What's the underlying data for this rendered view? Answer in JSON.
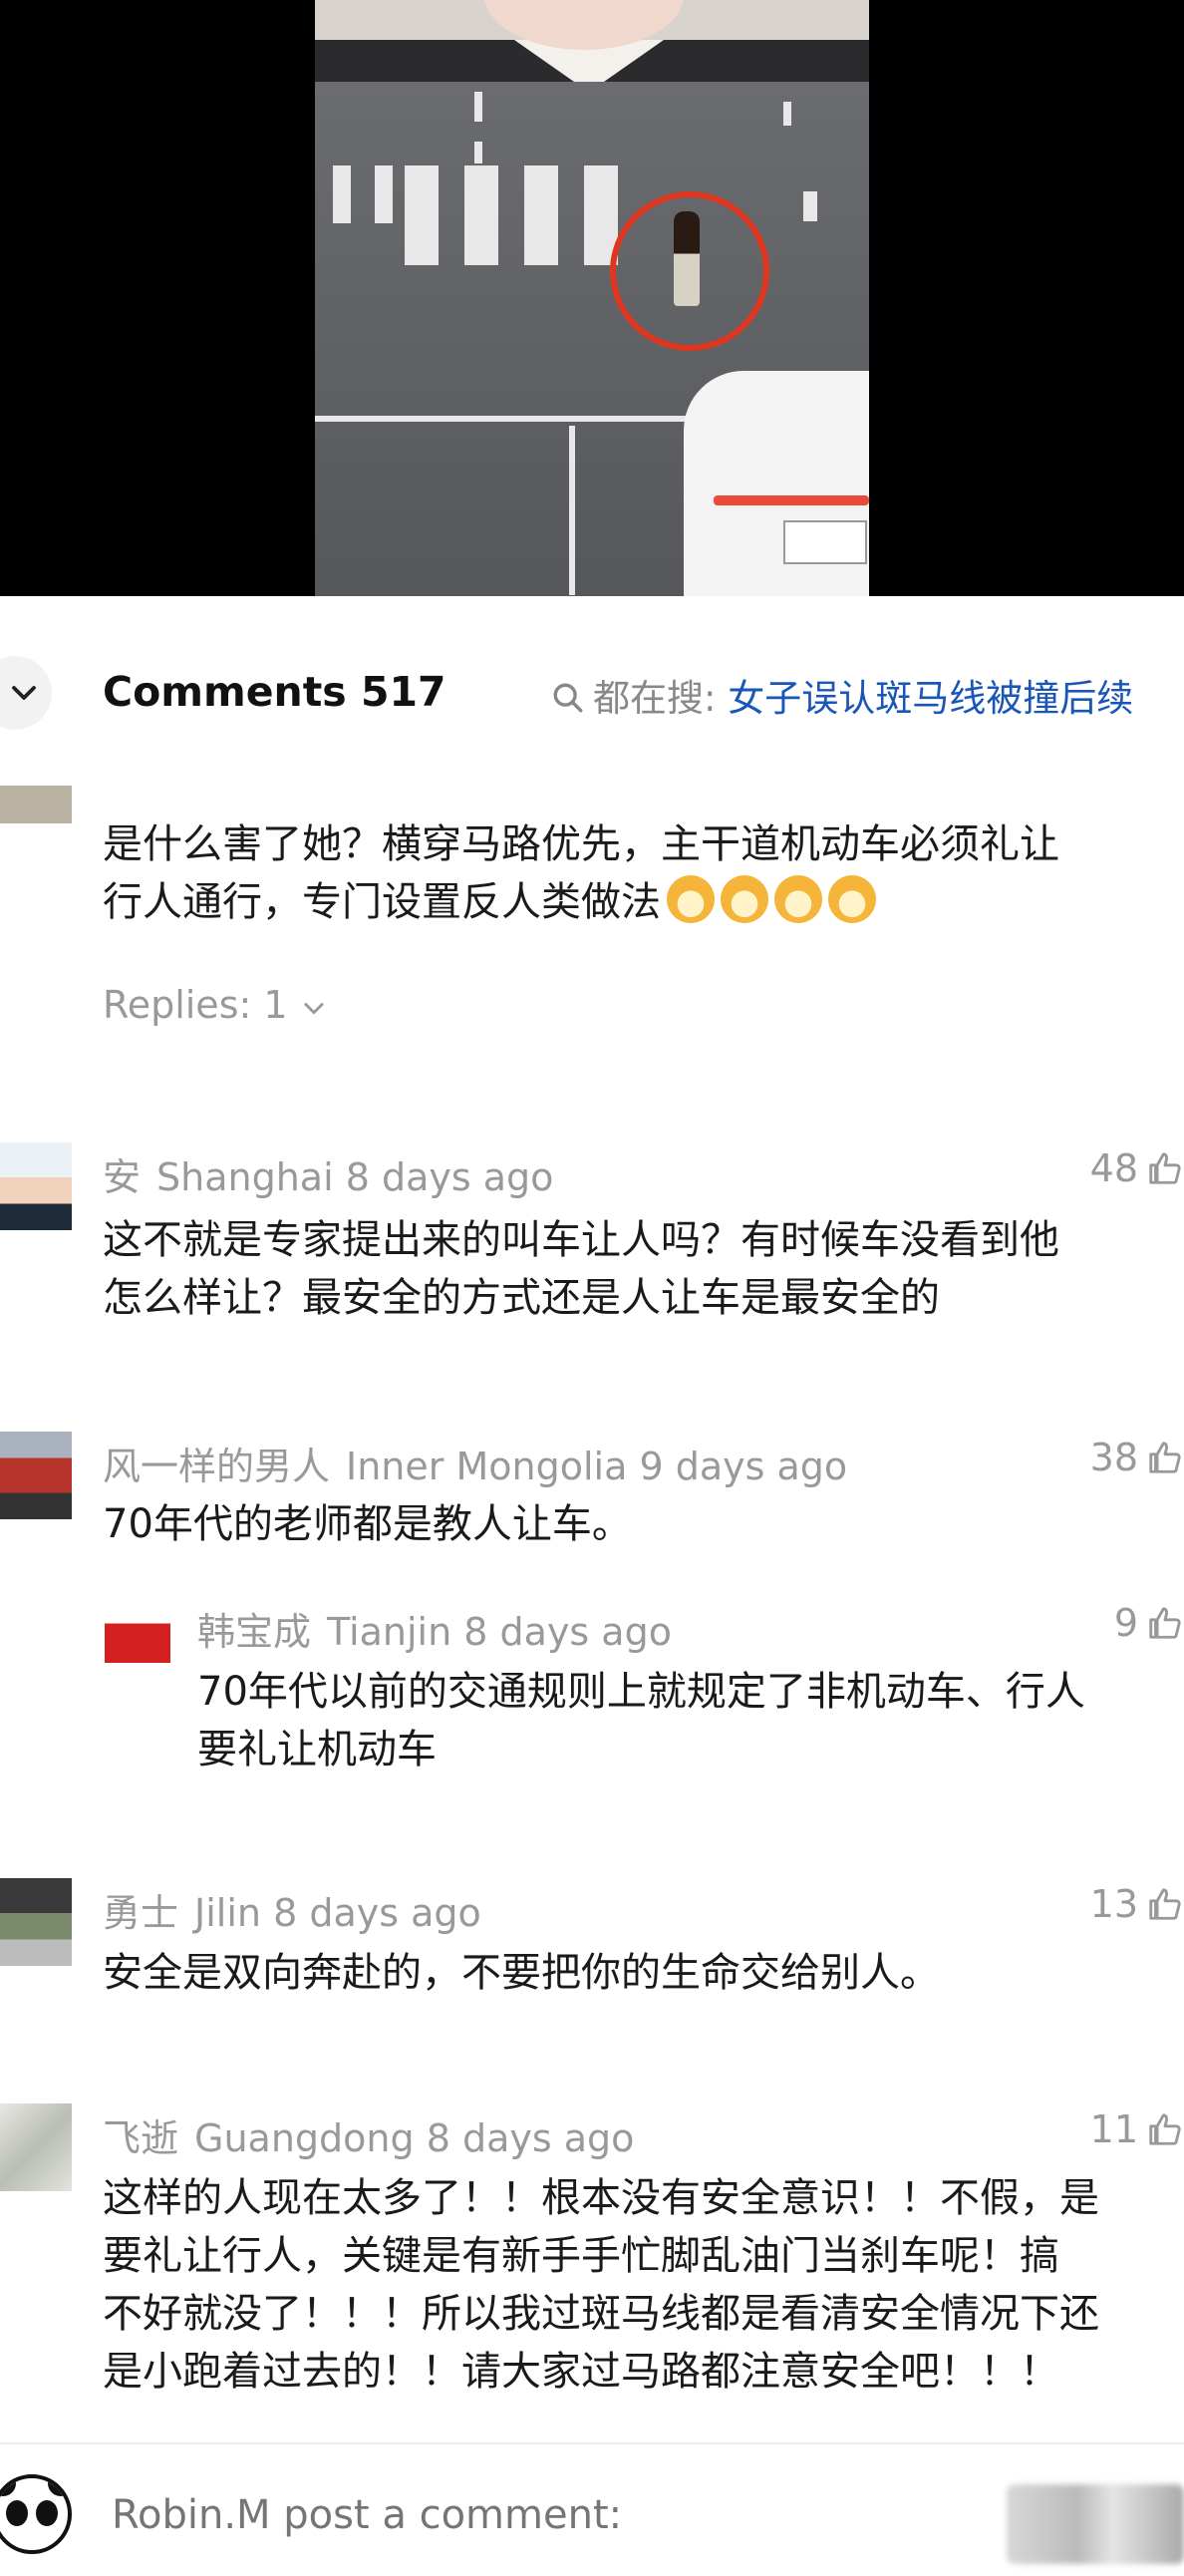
{
  "header": {
    "comments_label": "Comments 517",
    "search_prefix": "都在搜:",
    "search_link": "女子误认斑马线被撞后续"
  },
  "comments": [
    {
      "text_lines": [
        "是什么害了她？横穿马路优先，主干道机动车必须礼让",
        "行人通行，专门设置反人类做法"
      ],
      "emoji_count": 4,
      "replies": "Replies: 1"
    },
    {
      "name": "安",
      "location": "Shanghai",
      "time": "8 days ago",
      "likes": "48",
      "text_lines": [
        "这不就是专家提出来的叫车让人吗？有时候车没看到他",
        "怎么样让？最安全的方式还是人让车是最安全的"
      ]
    },
    {
      "name": "风一样的男人",
      "location": "Inner Mongolia",
      "time": "9 days ago",
      "likes": "38",
      "text_lines": [
        "70年代的老师都是教人让车。"
      ],
      "reply": {
        "name": "韩宝成",
        "location": "Tianjin",
        "time": "8 days ago",
        "likes": "9",
        "text_lines": [
          "70年代以前的交通规则上就规定了非机动车、行人",
          "要礼让机动车"
        ]
      }
    },
    {
      "name": "勇士",
      "location": "Jilin",
      "time": "8 days ago",
      "likes": "13",
      "text_lines": [
        "安全是双向奔赴的，不要把你的生命交给别人。"
      ]
    },
    {
      "name": "飞逝",
      "location": "Guangdong",
      "time": "8 days ago",
      "likes": "11",
      "text_lines": [
        "这样的人现在太多了！！根本没有安全意识！！不假，是",
        "要礼让行人，关键是有新手手忙脚乱油门当刹车呢！搞",
        "不好就没了！！！所以我过斑马线都是看清安全情况下还",
        "是小跑着过去的！！请大家过马路都注意安全吧！！！"
      ]
    }
  ],
  "composer": {
    "placeholder": "Robin.M post a comment:"
  },
  "colors": {
    "link": "#1a56b8",
    "meta": "#999999",
    "circle": "#e0361f"
  },
  "icons": [
    "chevron-down-icon",
    "search-icon",
    "thumbs-up-icon",
    "panda-avatar-icon"
  ]
}
